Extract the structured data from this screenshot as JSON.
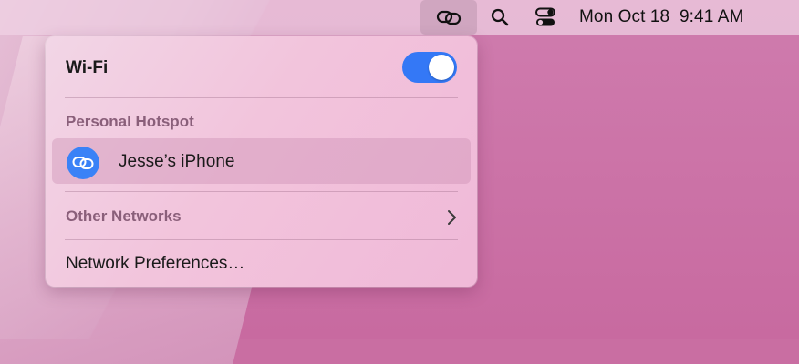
{
  "menubar": {
    "hotspot_icon": "personal-hotspot-link-icon",
    "search_icon": "search-icon",
    "control_center_icon": "control-center-icon",
    "date": "Mon Oct 18",
    "time": "9:41 AM"
  },
  "panel": {
    "wifi_label": "Wi-Fi",
    "wifi_enabled": true,
    "personal_hotspot_header": "Personal Hotspot",
    "hotspot_network": {
      "name": "Jesse’s iPhone",
      "icon": "personal-hotspot-link-icon"
    },
    "other_networks_label": "Other Networks",
    "network_preferences_label": "Network Preferences…"
  },
  "colors": {
    "toggle_on": "#3478f6",
    "hotspot_icon_bg": "#3a82f7",
    "section_header": "#8a5f7a"
  }
}
